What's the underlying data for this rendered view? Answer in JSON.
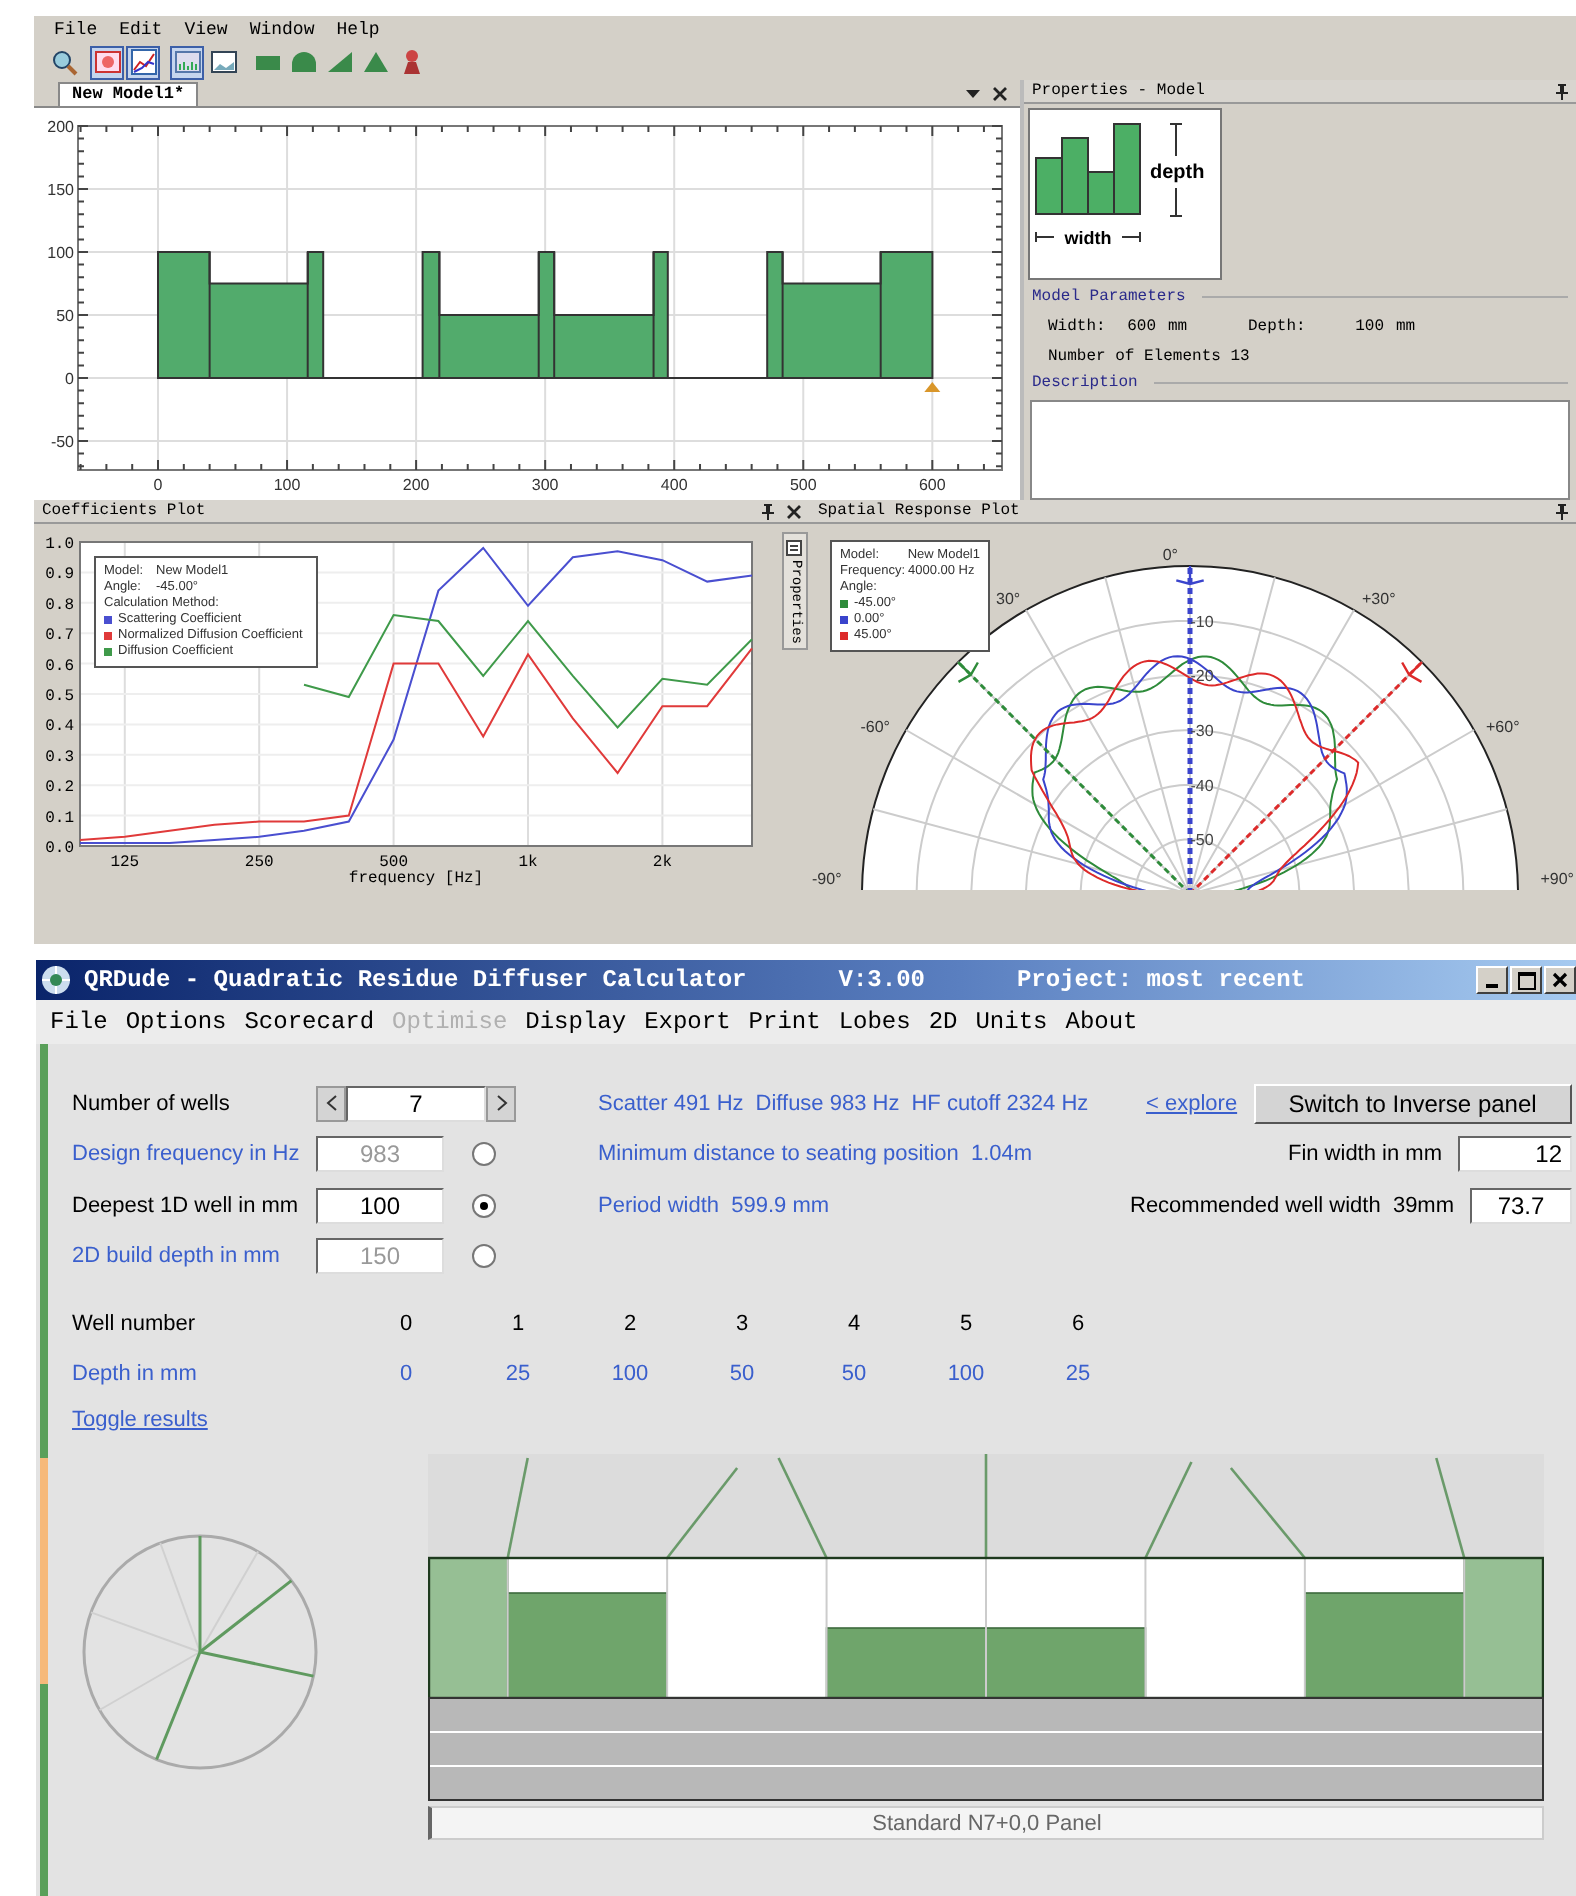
{
  "top_window": {
    "menu": [
      "File",
      "Edit",
      "View",
      "Window",
      "Help"
    ],
    "toolbar": [
      {
        "pressed": false
      },
      {
        "pressed": true
      },
      {
        "pressed": true
      },
      {
        "pressed": true
      },
      {
        "pressed": false
      },
      {
        "pressed": false
      },
      {
        "pressed": false
      },
      {
        "pressed": false
      },
      {
        "pressed": false
      },
      {
        "pressed": false
      }
    ],
    "document_tab": {
      "label": "New Model1*",
      "selected": true
    },
    "model_plot": {
      "chart_data": {
        "type": "area",
        "x": [
          0,
          0,
          40,
          40,
          116,
          116,
          128,
          128,
          205,
          205,
          218,
          218,
          295,
          295,
          307,
          307,
          384,
          384,
          395,
          395,
          472,
          472,
          484,
          484,
          560,
          560,
          600,
          600
        ],
        "grid": true,
        "series": [
          {
            "color": "#52ab6c",
            "values": [
              0,
              100,
              100,
              75,
              75,
              100,
              100,
              0,
              0,
              100,
              100,
              50,
              50,
              100,
              100,
              50,
              50,
              100,
              100,
              0,
              0,
              100,
              100,
              75,
              75,
              100,
              100,
              0
            ]
          }
        ],
        "xlim": [
          -62,
          654
        ],
        "ylim": [
          -73,
          200
        ],
        "xticks": [
          0,
          100,
          200,
          300,
          400,
          500,
          600
        ],
        "yticks": [
          -50,
          0,
          50,
          100,
          150,
          200
        ]
      }
    },
    "properties": {
      "title": "Properties - Model",
      "diagram": {
        "depth_label": "depth",
        "width_label": "width"
      },
      "parameters_heading": "Model Parameters",
      "parameters": [
        {
          "label": "Width:",
          "value": "600",
          "unit": "mm"
        },
        {
          "label": "Depth:",
          "value": "100",
          "unit": "mm"
        }
      ],
      "elements": "Number of Elements 13",
      "description_heading": "Description"
    },
    "coefficients_plot": {
      "title": "Coefficients Plot",
      "legend": {
        "rows": [
          {
            "label": "Model:",
            "value": "New Model1"
          },
          {
            "label": "Angle:",
            "value": "-45.00°"
          }
        ],
        "method": "Calculation Method:"
      },
      "chart_data": {
        "type": "line",
        "grid": true,
        "xlabel": "frequency [Hz]",
        "categories": [
          null,
          "125",
          null,
          null,
          "250",
          null,
          null,
          "500",
          null,
          null,
          "1k",
          null,
          null,
          "2k",
          null,
          null
        ],
        "series": [
          {
            "name": "Scattering Coefficient",
            "color": "#4a4fd0",
            "values": [
              0.01,
              0.01,
              0.01,
              0.02,
              0.03,
              0.05,
              0.08,
              0.35,
              0.84,
              0.98,
              0.79,
              0.95,
              0.97,
              0.94,
              0.87,
              0.89
            ]
          },
          {
            "name": "Normalized Diffusion Coefficient",
            "color": "#e03a3a",
            "values": [
              0.02,
              0.03,
              0.05,
              0.07,
              0.08,
              0.08,
              0.1,
              0.6,
              0.6,
              0.36,
              0.63,
              0.42,
              0.24,
              0.46,
              0.46,
              0.65
            ]
          },
          {
            "name": "Diffusion Coefficient",
            "color": "#3f9a4a",
            "values": [
              null,
              null,
              null,
              null,
              null,
              0.53,
              0.49,
              0.76,
              0.74,
              0.56,
              0.74,
              0.56,
              0.39,
              0.55,
              0.53,
              0.68
            ]
          }
        ],
        "ylim": [
          0,
          1
        ],
        "yticks": [
          {
            "value": 0,
            "label": "0.0"
          },
          {
            "value": 0.1,
            "label": "0.1"
          },
          {
            "value": 0.2,
            "label": "0.2"
          },
          {
            "value": 0.3,
            "label": "0.3"
          },
          {
            "value": 0.4,
            "label": "0.4"
          },
          {
            "value": 0.5,
            "label": "0.5"
          },
          {
            "value": 0.6,
            "label": "0.6"
          },
          {
            "value": 0.7,
            "label": "0.7"
          },
          {
            "value": 0.8,
            "label": "0.8"
          },
          {
            "value": 0.9,
            "label": "0.9"
          },
          {
            "value": 1,
            "label": "1.0"
          }
        ]
      }
    },
    "side_tab": "Properties",
    "spatial_plot": {
      "title": "Spatial Response Plot",
      "legend": {
        "rows": [
          {
            "label": "Model:",
            "value": "New Model1"
          },
          {
            "label": "Frequency:",
            "value": "4000.00 Hz"
          }
        ],
        "heading": "Angle:",
        "entries": [
          {
            "label": "-45.00°",
            "color": "#2e8b3a"
          },
          {
            "label": "0.00°",
            "color": "#3a44cc"
          },
          {
            "label": "45.00°",
            "color": "#dd2a2a"
          }
        ]
      },
      "ring_labels": [
        "-10",
        "-20",
        "-30",
        "-40",
        "-50"
      ],
      "angle_labels": [
        "0°",
        "30°",
        "+30°",
        "-60°",
        "+60°",
        "-90°",
        "+90°"
      ]
    }
  },
  "qrdude": {
    "title": "QRDude - Quadratic Residue Diffuser Calculator",
    "version": "V:3.00",
    "project": "Project: most recent",
    "menu": [
      {
        "label": "File",
        "disabled": false
      },
      {
        "label": "Options",
        "disabled": false
      },
      {
        "label": "Scorecard",
        "disabled": false
      },
      {
        "label": "Optimise",
        "disabled": true
      },
      {
        "label": "Display",
        "disabled": false
      },
      {
        "label": "Export",
        "disabled": false
      },
      {
        "label": "Print",
        "disabled": false
      },
      {
        "label": "Lobes",
        "disabled": false
      },
      {
        "label": "2D",
        "disabled": false
      },
      {
        "label": "Units",
        "disabled": false
      },
      {
        "label": "About",
        "disabled": false
      }
    ],
    "rows": [
      {
        "kind": "spinner",
        "label": "Number of wells",
        "value": "7"
      },
      {
        "kind": "radio",
        "label": "Design frequency in Hz",
        "value": "983",
        "selected": false
      },
      {
        "kind": "radio",
        "label": "Deepest 1D well in mm",
        "value": "100",
        "selected": true
      },
      {
        "kind": "radio",
        "label": "2D build depth in mm",
        "value": "150",
        "selected": false
      }
    ],
    "info": [
      {
        "parts": [
          "Scatter 491 Hz",
          "Diffuse 983 Hz",
          "HF cutoff 2324 Hz"
        ]
      },
      {
        "parts": [
          "Minimum distance to seating position  1.04m"
        ]
      },
      {
        "parts": [
          "Period width  599.9 mm"
        ]
      }
    ],
    "explore_link": "< explore",
    "inverse_button": "Switch to Inverse panel",
    "fin_width": {
      "label": "Fin width in mm",
      "value": "12"
    },
    "recommended": {
      "label": "Recommended well width  39mm",
      "value": "73.7"
    },
    "wells": {
      "number_label": "Well number",
      "depth_label": "Depth in mm",
      "numbers": [
        "0",
        "1",
        "2",
        "3",
        "4",
        "5",
        "6"
      ],
      "depths": [
        "0",
        "25",
        "100",
        "50",
        "50",
        "100",
        "25"
      ]
    },
    "toggle_link": "Toggle results",
    "panel_caption": "Standard N7+0,0 Panel"
  }
}
